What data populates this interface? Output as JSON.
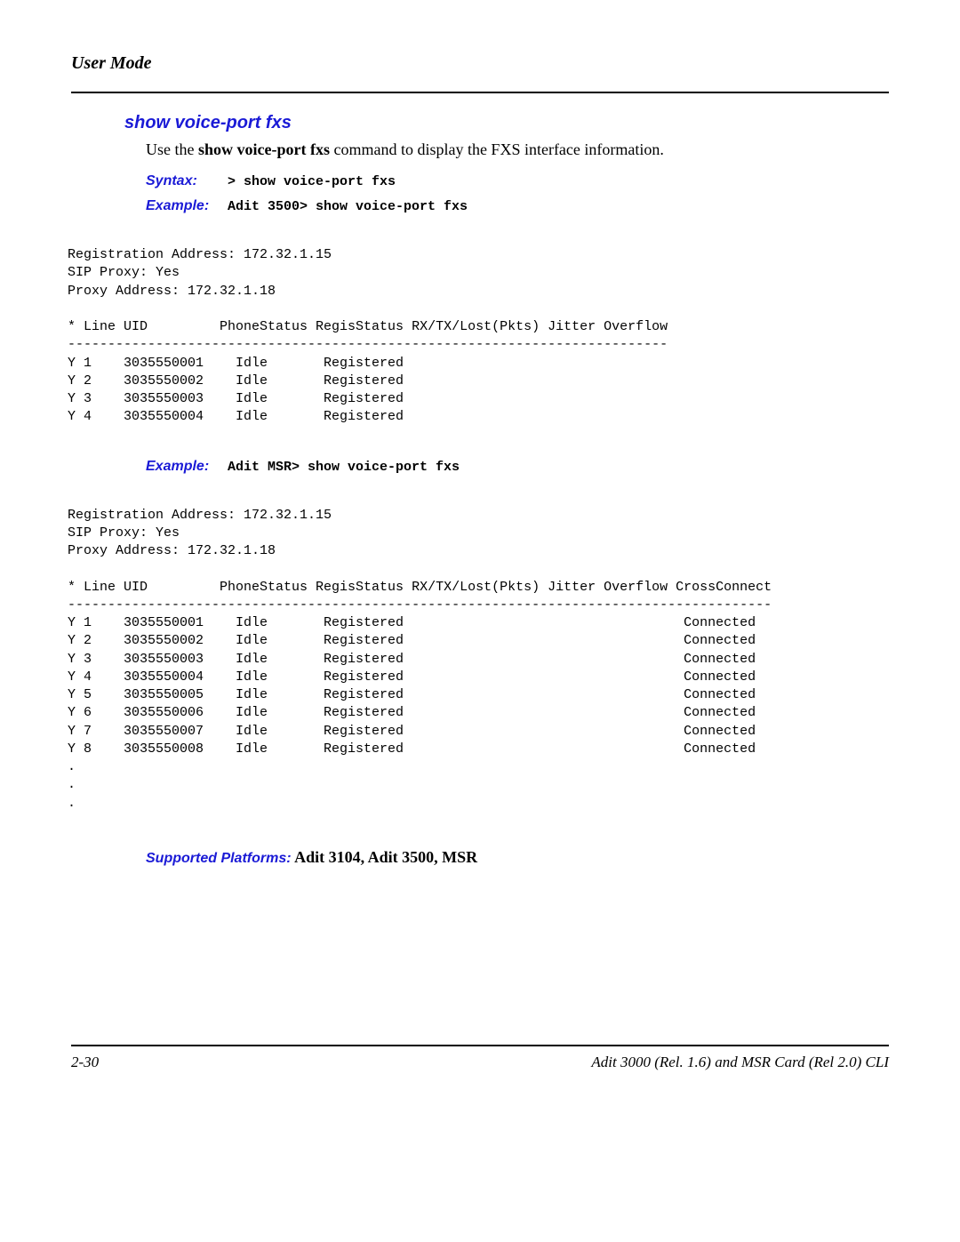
{
  "header": {
    "title": "User Mode"
  },
  "section": {
    "title": "show voice-port fxs",
    "description_pre": "Use the ",
    "description_cmd": "show voice-port fxs",
    "description_post": " command to display the FXS interface information.",
    "syntax_label": "Syntax:",
    "syntax_value": "> show voice-port fxs",
    "example1_label": "Example:",
    "example1_value": "Adit 3500> show voice-port fxs",
    "example2_label": "Example:",
    "example2_value": "Adit MSR> show voice-port fxs",
    "supported_label": "Supported Platforms:",
    "supported_value": "  Adit 3104, Adit 3500, MSR"
  },
  "output1": {
    "reg_addr_line": "Registration Address: 172.32.1.15",
    "sip_line": "SIP Proxy: Yes",
    "proxy_line": "Proxy Address: 172.32.1.18",
    "header_row": "* Line UID         PhoneStatus RegisStatus RX/TX/Lost(Pkts) Jitter Overflow",
    "divider": "---------------------------------------------------------------------------",
    "rows": [
      "Y 1    3035550001    Idle       Registered",
      "Y 2    3035550002    Idle       Registered",
      "Y 3    3035550003    Idle       Registered",
      "Y 4    3035550004    Idle       Registered"
    ]
  },
  "output2": {
    "reg_addr_line": "Registration Address: 172.32.1.15",
    "sip_line": "SIP Proxy: Yes",
    "proxy_line": "Proxy Address: 172.32.1.18",
    "header_row": "* Line UID         PhoneStatus RegisStatus RX/TX/Lost(Pkts) Jitter Overflow CrossConnect",
    "divider": "----------------------------------------------------------------------------------------",
    "rows": [
      "Y 1    3035550001    Idle       Registered                                   Connected",
      "Y 2    3035550002    Idle       Registered                                   Connected",
      "Y 3    3035550003    Idle       Registered                                   Connected",
      "Y 4    3035550004    Idle       Registered                                   Connected",
      "Y 5    3035550005    Idle       Registered                                   Connected",
      "Y 6    3035550006    Idle       Registered                                   Connected",
      "Y 7    3035550007    Idle       Registered                                   Connected",
      "Y 8    3035550008    Idle       Registered                                   Connected",
      ".",
      ".",
      "."
    ]
  },
  "footer": {
    "left": "2-30",
    "right": "Adit 3000 (Rel. 1.6) and MSR Card (Rel 2.0) CLI"
  }
}
